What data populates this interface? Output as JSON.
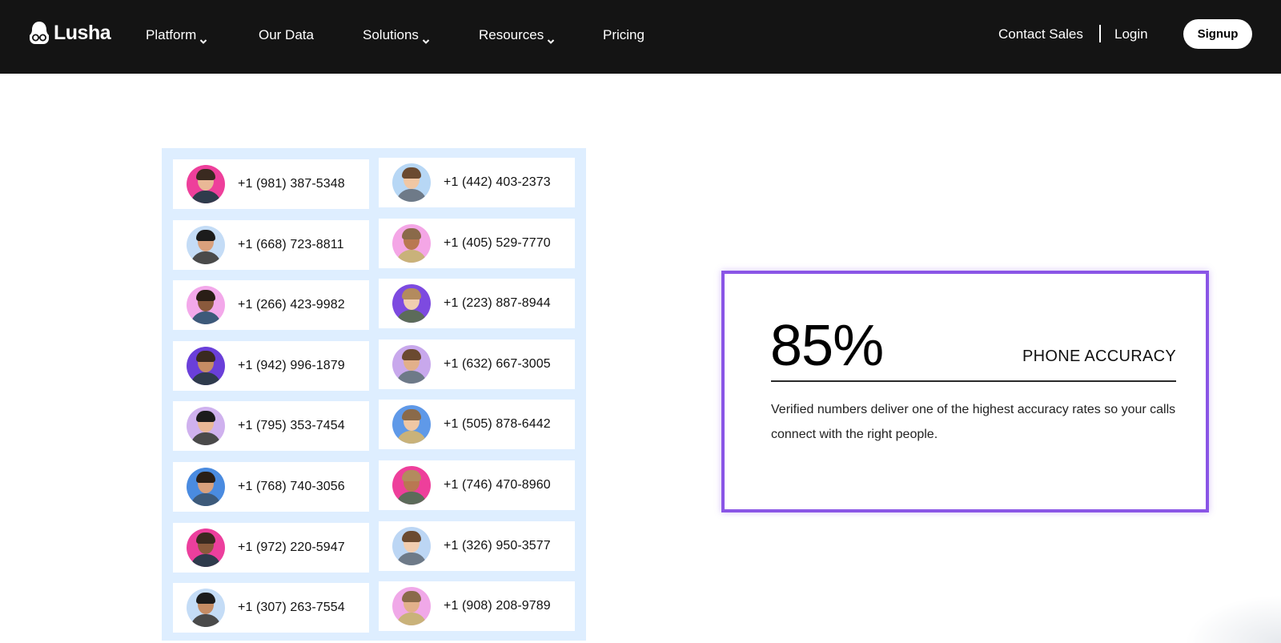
{
  "nav": {
    "logo": "Lusha",
    "items": [
      {
        "label": "Platform",
        "dropdown": true
      },
      {
        "label": "Our Data",
        "dropdown": false
      },
      {
        "label": "Solutions",
        "dropdown": true
      },
      {
        "label": "Resources",
        "dropdown": true
      },
      {
        "label": "Pricing",
        "dropdown": false
      }
    ],
    "contact_sales": "Contact Sales",
    "login": "Login",
    "signup": "Signup"
  },
  "contacts": [
    {
      "phone": "+1 (981) 387-5348",
      "bg": "#ee3f9b"
    },
    {
      "phone": "+1 (442) 403-2373",
      "bg": "#b7d7f5"
    },
    {
      "phone": "+1 (668) 723-8811",
      "bg": "#c4dcf6"
    },
    {
      "phone": "+1 (405) 529-7770",
      "bg": "#f4a6e6"
    },
    {
      "phone": "+1 (266) 423-9982",
      "bg": "#f3a8ea"
    },
    {
      "phone": "+1 (223) 887-8944",
      "bg": "#7d4ae0"
    },
    {
      "phone": "+1 (942) 996-1879",
      "bg": "#6a3fd9"
    },
    {
      "phone": "+1 (632) 667-3005",
      "bg": "#c8a8ec"
    },
    {
      "phone": "+1 (795) 353-7454",
      "bg": "#cfb1ee"
    },
    {
      "phone": "+1 (505) 878-6442",
      "bg": "#5f99e8"
    },
    {
      "phone": "+1 (768) 740-3056",
      "bg": "#4a8be0"
    },
    {
      "phone": "+1 (746) 470-8960",
      "bg": "#ee3f9b"
    },
    {
      "phone": "+1 (972) 220-5947",
      "bg": "#ec3f9d"
    },
    {
      "phone": "+1 (326) 950-3577",
      "bg": "#bcd6f4"
    },
    {
      "phone": "+1 (307) 263-7554",
      "bg": "#c4dcf6"
    },
    {
      "phone": "+1 (908) 208-9789",
      "bg": "#f0a8e8"
    }
  ],
  "stat": {
    "value": "85%",
    "label": "PHONE ACCURACY",
    "description": "Verified numbers deliver one of the highest accuracy rates so your calls connect with the right people."
  },
  "colors": {
    "nav_bg": "#141414",
    "grid_bg": "#deeeff",
    "accent_border": "#8a55e6"
  }
}
